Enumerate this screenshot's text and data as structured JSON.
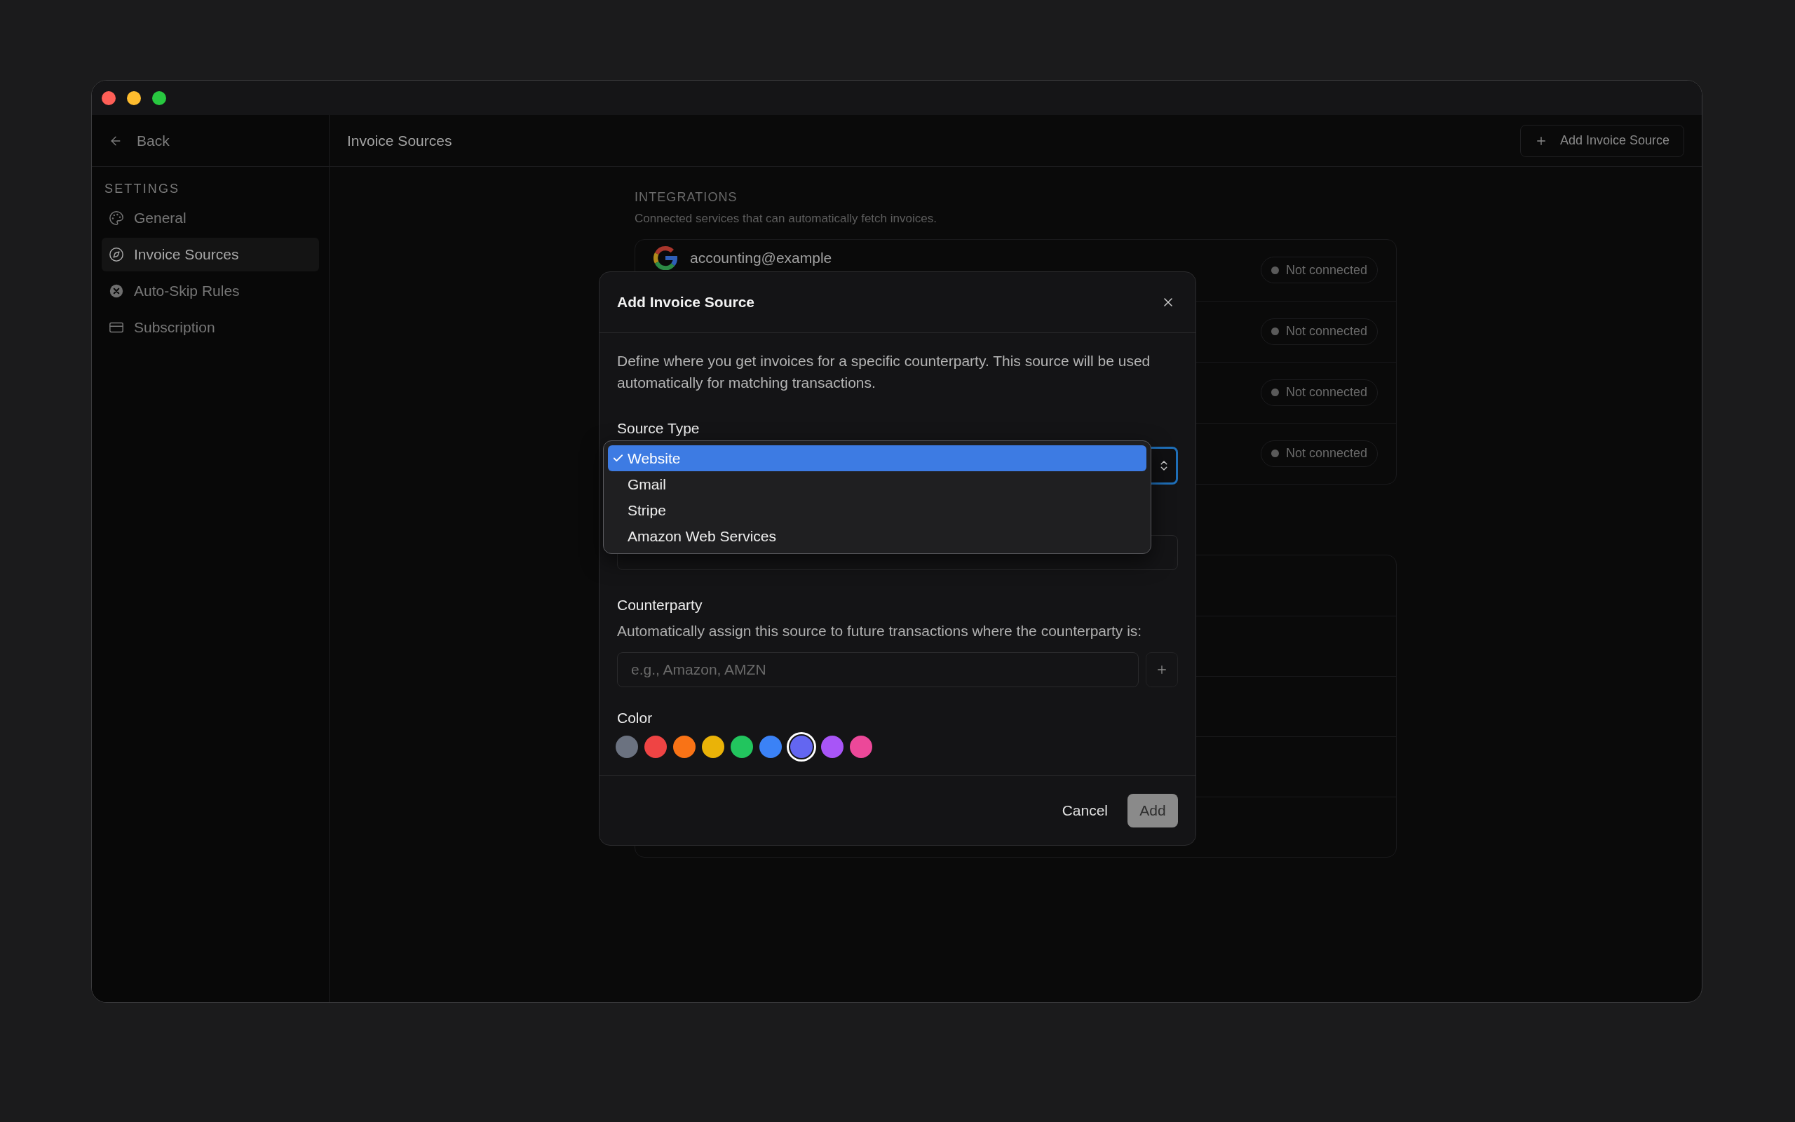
{
  "window": {
    "controls": [
      {
        "color": "#fe5f57"
      },
      {
        "color": "#febc2e"
      },
      {
        "color": "#28c840"
      }
    ]
  },
  "sidebar": {
    "back": "Back",
    "section": "SETTINGS",
    "items": [
      {
        "label": "General",
        "kind": "palette",
        "selected": false
      },
      {
        "label": "Invoice Sources",
        "kind": "compass",
        "selected": true
      },
      {
        "label": "Auto-Skip Rules",
        "kind": "skip",
        "selected": false
      },
      {
        "label": "Subscription",
        "kind": "card",
        "selected": false
      }
    ]
  },
  "header": {
    "title": "Invoice Sources",
    "action": "Add Invoice Source"
  },
  "integrations": {
    "heading": "INTEGRATIONS",
    "description": "Connected services that can automatically fetch invoices.",
    "items": [
      {
        "kind": "google",
        "account": "accounting@example",
        "status": "Not connected",
        "connected": false
      },
      {
        "kind": "hidden",
        "status": "Not connected",
        "connected": false
      },
      {
        "kind": "hidden",
        "status": "Not connected",
        "connected": false
      },
      {
        "kind": "hidden",
        "status": "Not connected",
        "connected": false
      }
    ]
  },
  "dialog": {
    "title": "Add Invoice Source",
    "description": "Define where you get invoices for a specific counterparty. This source will be used automatically for matching transactions.",
    "source_type": {
      "label": "Source Type",
      "options": [
        {
          "label": "Website",
          "selected": true
        },
        {
          "label": "Gmail",
          "selected": false
        },
        {
          "label": "Stripe",
          "selected": false
        },
        {
          "label": "Amazon Web Services",
          "selected": false
        }
      ]
    },
    "counterparty": {
      "label": "Counterparty",
      "hint": "Automatically assign this source to future transactions where the counterparty is:",
      "placeholder": "e.g., Amazon, AMZN"
    },
    "color": {
      "label": "Color",
      "swatches": [
        {
          "color": "#6b7280",
          "selected": false
        },
        {
          "color": "#ef4444",
          "selected": false
        },
        {
          "color": "#f97316",
          "selected": false
        },
        {
          "color": "#eab308",
          "selected": false
        },
        {
          "color": "#22c55e",
          "selected": false
        },
        {
          "color": "#3b82f6",
          "selected": false
        },
        {
          "color": "#6366f1",
          "selected": true
        },
        {
          "color": "#a855f7",
          "selected": false
        },
        {
          "color": "#ec4899",
          "selected": false
        }
      ]
    },
    "cancel": "Cancel",
    "add": "Add",
    "add_disabled": true
  }
}
